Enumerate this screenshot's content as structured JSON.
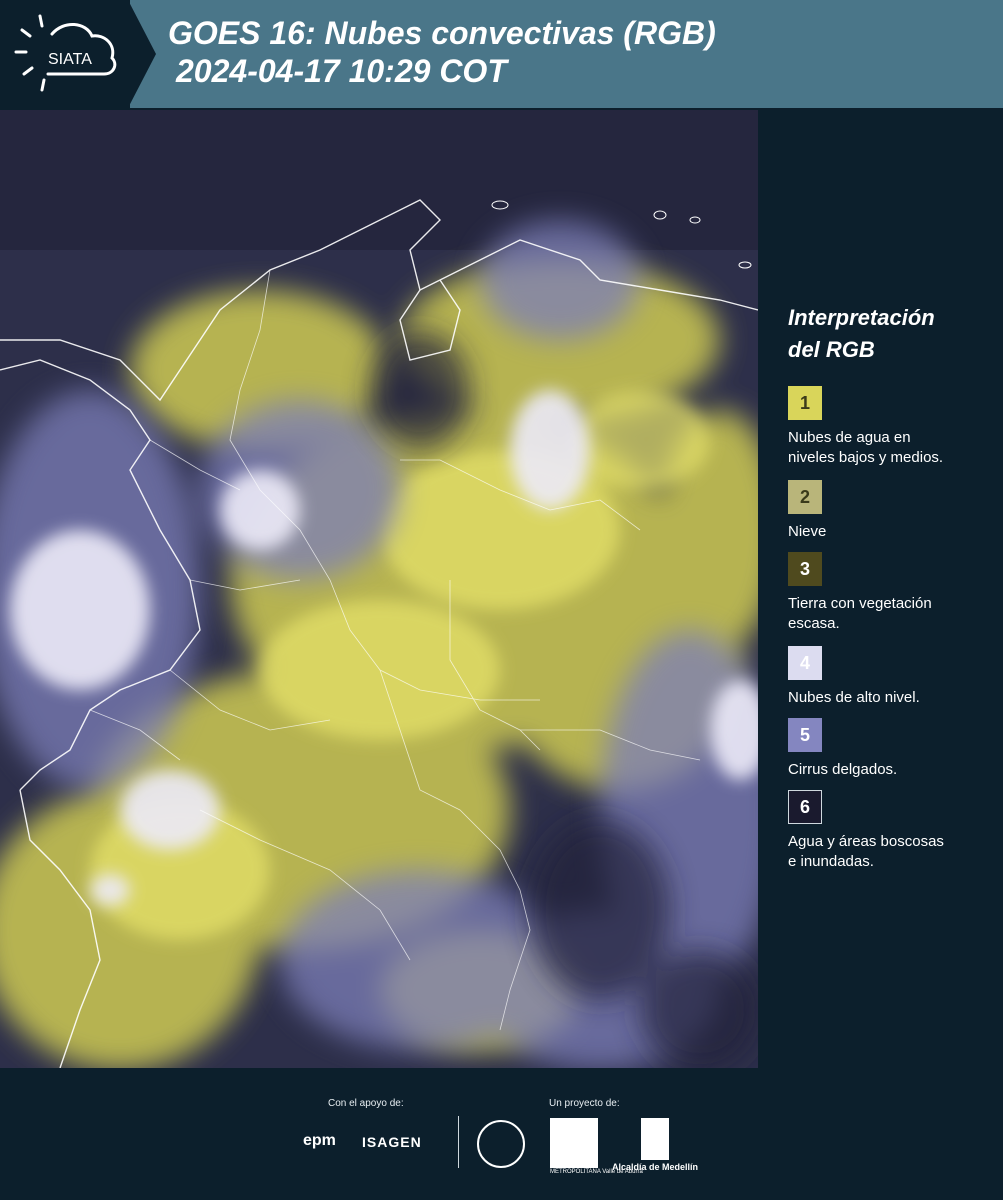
{
  "header": {
    "logo_text": "SIATA",
    "title": "GOES 16: Nubes convectivas (RGB)",
    "datetime": "2024-04-17 10:29 COT"
  },
  "legend": {
    "title_line1": "Interpretación",
    "title_line2": "del RGB",
    "items": [
      {
        "number": "1",
        "text_line1": "Nubes de agua en",
        "text_line2": "niveles bajos y medios.",
        "color": "#d9d55a",
        "text_color": "#3a3a1a"
      },
      {
        "number": "2",
        "text_line1": "Nieve",
        "text_line2": "",
        "color": "#b9b57a",
        "text_color": "#3a3a1a"
      },
      {
        "number": "3",
        "text_line1": "Tierra con vegetación",
        "text_line2": "escasa.",
        "color": "#4f4a1e",
        "text_color": "#ffffff"
      },
      {
        "number": "4",
        "text_line1": "Nubes de alto nivel.",
        "text_line2": "",
        "color": "#dcdcf0",
        "text_color": "#ffffff"
      },
      {
        "number": "5",
        "text_line1": "Cirrus delgados.",
        "text_line2": "",
        "color": "#8486c0",
        "text_color": "#ffffff"
      },
      {
        "number": "6",
        "text_line1": "Agua y áreas boscosas",
        "text_line2": "e inundadas.",
        "color": "#1a1a2e",
        "text_color": "#ffffff"
      }
    ]
  },
  "footer": {
    "support_label": "Con el apoyo de:",
    "project_label": "Un proyecto de:",
    "sponsor_1": "epm",
    "sponsor_2": "ISAGEN",
    "area_text": "METROPOLITANA Valle de Aburrá",
    "alcaldia": "Alcaldía de Medellín"
  },
  "colors": {
    "header_bg": "#4a7689",
    "panel_bg": "#0c1f2c",
    "cloud_yellow": "#d9d55a",
    "cloud_white": "#e6e6f5",
    "cirrus": "#7d7fb8"
  }
}
